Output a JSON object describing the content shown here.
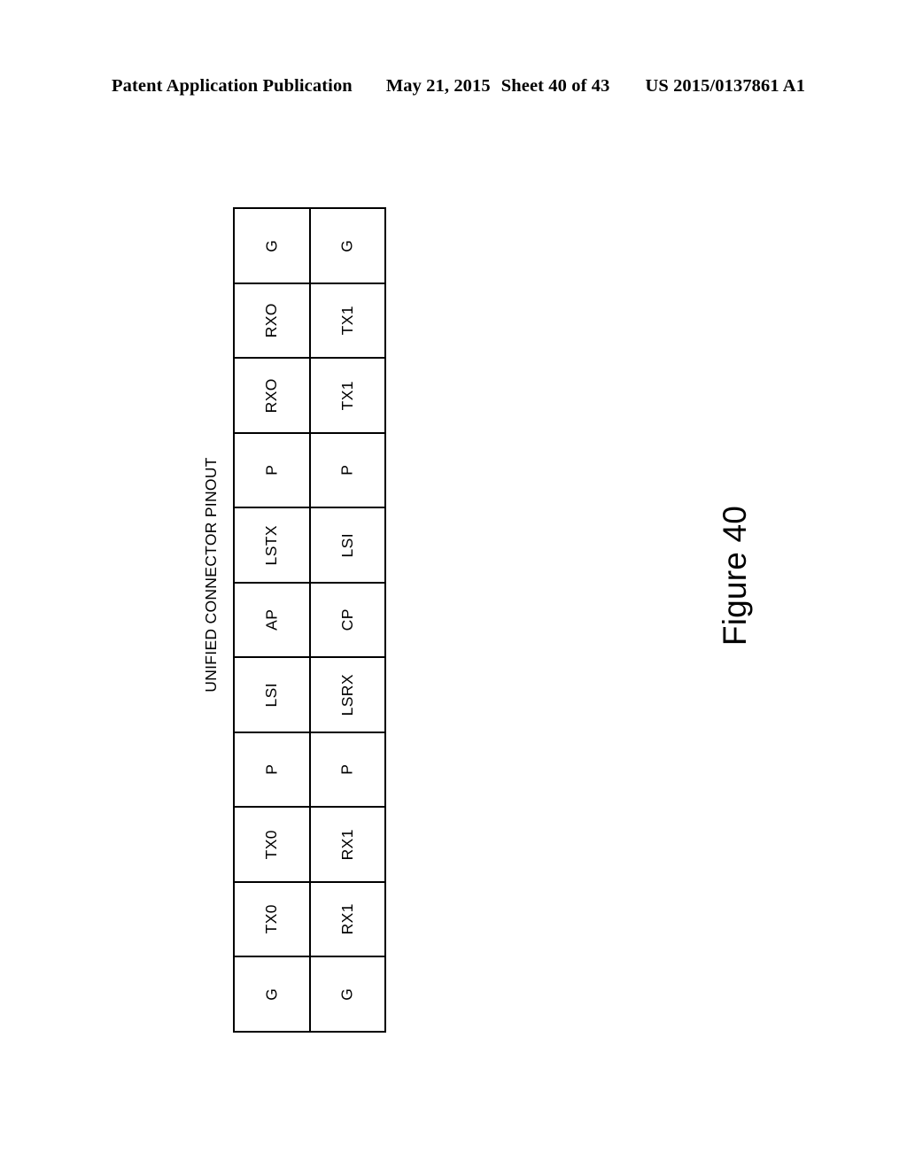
{
  "header": {
    "publication": "Patent Application Publication",
    "date": "May 21, 2015",
    "sheet": "Sheet 40 of 43",
    "patent_number": "US 2015/0137861 A1"
  },
  "figure": {
    "caption": "Figure 40",
    "table_title": "UNIFIED CONNECTOR PINOUT"
  },
  "chart_data": {
    "type": "table",
    "title": "UNIFIED CONNECTOR PINOUT",
    "orientation": "rotated-90-ccw",
    "columns": 2,
    "rows": 11,
    "cells": [
      [
        "G",
        "G"
      ],
      [
        "RXO",
        "TX1"
      ],
      [
        "RXO",
        "TX1"
      ],
      [
        "P",
        "P"
      ],
      [
        "LSTX",
        "LSI"
      ],
      [
        "AP",
        "CP"
      ],
      [
        "LSI",
        "LSRX"
      ],
      [
        "P",
        "P"
      ],
      [
        "TX0",
        "RX1"
      ],
      [
        "TX0",
        "RX1"
      ],
      [
        "G",
        "G"
      ]
    ]
  }
}
